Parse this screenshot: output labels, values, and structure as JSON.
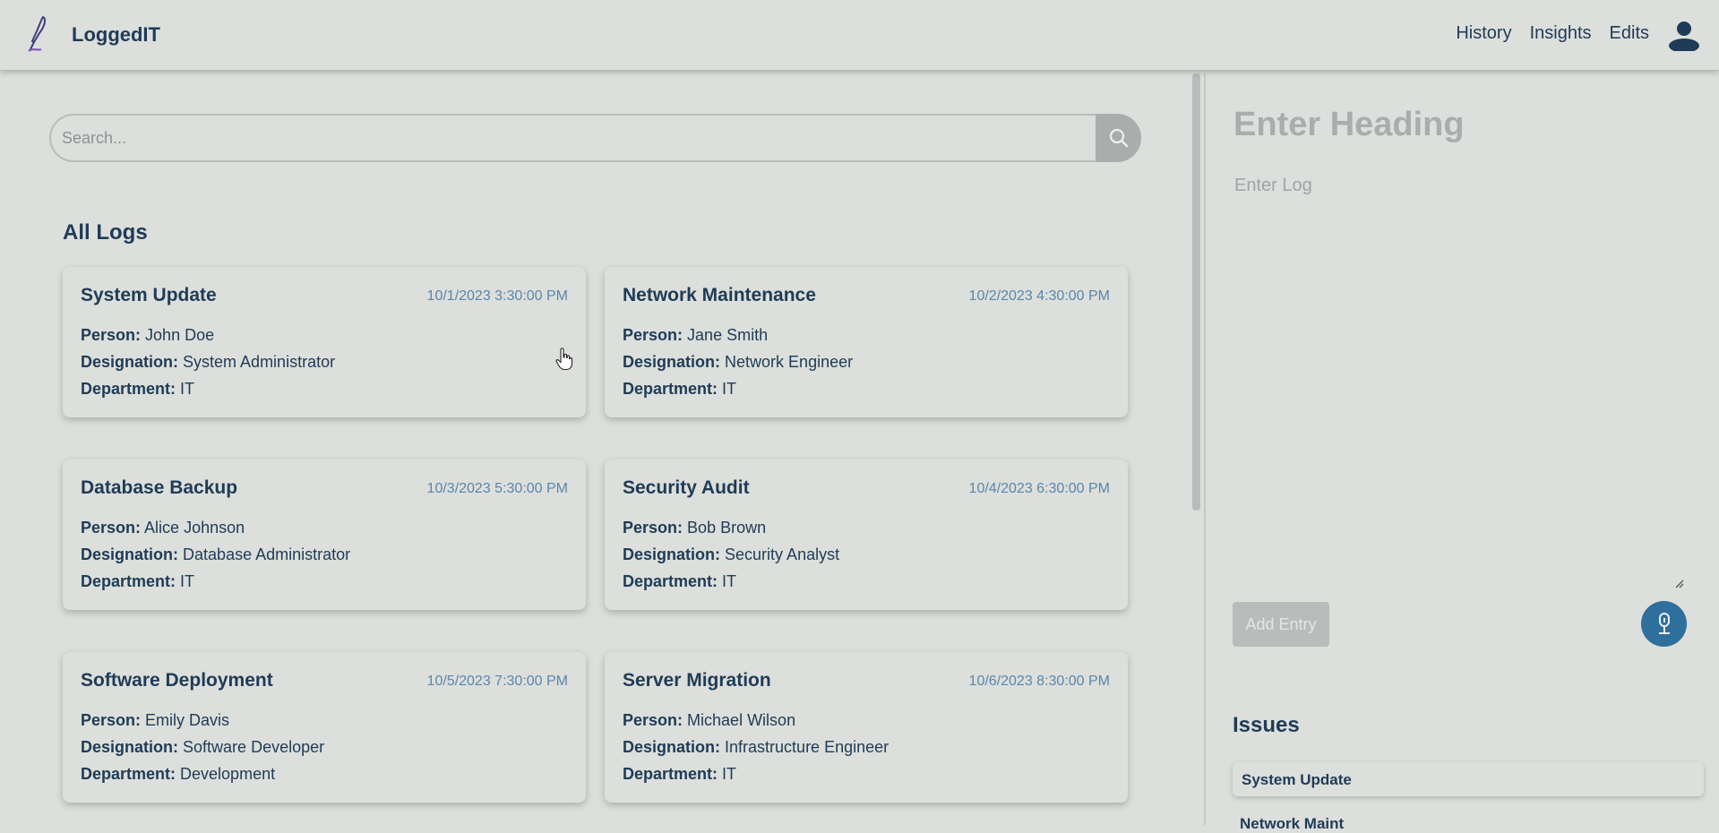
{
  "app": {
    "name": "LoggedIT"
  },
  "nav": {
    "links": [
      "History",
      "Insights",
      "Edits"
    ]
  },
  "search": {
    "placeholder": "Search..."
  },
  "logs": {
    "title": "All Logs",
    "field_labels": {
      "person": "Person:",
      "designation": "Designation:",
      "department": "Department:"
    },
    "items": [
      {
        "title": "System Update",
        "date": "10/1/2023 3:30:00 PM",
        "person": "John Doe",
        "designation": "System Administrator",
        "department": "IT"
      },
      {
        "title": "Network Maintenance",
        "date": "10/2/2023 4:30:00 PM",
        "person": "Jane Smith",
        "designation": "Network Engineer",
        "department": "IT"
      },
      {
        "title": "Database Backup",
        "date": "10/3/2023 5:30:00 PM",
        "person": "Alice Johnson",
        "designation": "Database Administrator",
        "department": "IT"
      },
      {
        "title": "Security Audit",
        "date": "10/4/2023 6:30:00 PM",
        "person": "Bob Brown",
        "designation": "Security Analyst",
        "department": "IT"
      },
      {
        "title": "Software Deployment",
        "date": "10/5/2023 7:30:00 PM",
        "person": "Emily Davis",
        "designation": "Software Developer",
        "department": "Development"
      },
      {
        "title": "Server Migration",
        "date": "10/6/2023 8:30:00 PM",
        "person": "Michael Wilson",
        "designation": "Infrastructure Engineer",
        "department": "IT"
      }
    ]
  },
  "editor": {
    "heading_placeholder": "Enter Heading",
    "log_placeholder": "Enter Log",
    "add_button": "Add Entry",
    "mic_icon": "microphone-icon"
  },
  "issues": {
    "title": "Issues",
    "items": [
      "System Update",
      "Network Maint"
    ]
  },
  "colors": {
    "background": "#dcdfdb",
    "text_primary": "#1f3b57",
    "date_text": "#5b86ad",
    "accent": "#2f6f9c",
    "disabled_button": "#b8bcba"
  }
}
